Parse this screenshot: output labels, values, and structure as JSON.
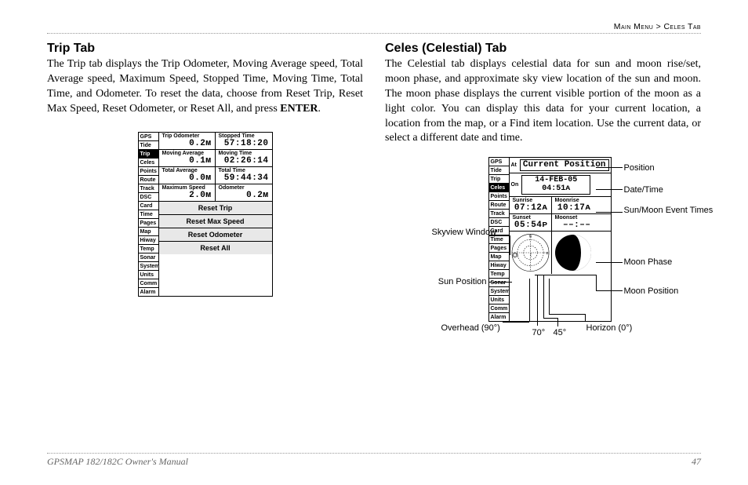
{
  "header": {
    "breadcrumb_left": "Main Menu",
    "breadcrumb_sep": " > ",
    "breadcrumb_right": "Celes Tab"
  },
  "left": {
    "title": "Trip Tab",
    "para_a": "The Trip tab displays the Trip Odometer, Moving Average speed, Total Average speed, Maximum Speed, Stopped Time, Moving Time, Total Time, and Odometer. To reset the data, choose from Reset Trip, Reset Max Speed, Reset Odometer, or Reset All, and press ",
    "para_b": "ENTER",
    "para_c": "."
  },
  "right": {
    "title": "Celes (Celestial) Tab",
    "para": "The Celestial tab displays celestial data for sun and moon rise/set, moon phase, and approximate sky view location of the sun and moon. The moon phase displays the current visible portion of the moon as a light color. You can display this data for your current location, a location from the map, or a Find item location. Use the current data, or select a different date and time."
  },
  "nav_items": [
    "GPS",
    "Tide",
    "Trip",
    "Celes",
    "Points",
    "Route",
    "Track",
    "DSC",
    "Card",
    "Time",
    "Pages",
    "Map",
    "Hiway",
    "Temp",
    "Sonar",
    "System",
    "Units",
    "Comm",
    "Alarm"
  ],
  "nav_sel_trip": "Trip",
  "nav_sel_celes": "Celes",
  "trip": {
    "r1": {
      "l_lab": "Trip Odometer",
      "l_val": "0.2ᴍ",
      "r_lab": "Stopped Time",
      "r_val": "57:18:20"
    },
    "r2": {
      "l_lab": "Moving Average",
      "l_val": "0.1ᴍ",
      "r_lab": "Moving Time",
      "r_val": "02:26:14"
    },
    "r3": {
      "l_lab": "Total Average",
      "l_val": "0.0ᴍ",
      "r_lab": "Total Time",
      "r_val": "59:44:34"
    },
    "r4": {
      "l_lab": "Maximum Speed",
      "l_val": "2.0ᴍ",
      "r_lab": "Odometer",
      "r_val": "0.2ᴍ"
    },
    "btn1": "Reset Trip",
    "btn2": "Reset Max Speed",
    "btn3": "Reset Odometer",
    "btn4": "Reset All"
  },
  "celes": {
    "at_lab": "At",
    "at_val": "Current Position",
    "on_lab": "On",
    "on_date": "14-FEB-05",
    "on_time": "04:51ᴀ",
    "sunrise_lab": "Sunrise",
    "sunrise": "07:12ᴀ",
    "moonrise_lab": "Moonrise",
    "moonrise": "10:17ᴀ",
    "sunset_lab": "Sunset",
    "sunset": "05:54ᴘ",
    "moonset_lab": "Moonset",
    "moonset": "––:––"
  },
  "callouts": {
    "position": "Position",
    "datetime": "Date/Time",
    "events": "Sun/Moon Event Times",
    "moonphase": "Moon Phase",
    "moonpos": "Moon Position",
    "skyview": "Skyview Window",
    "sunpos": "Sun Position",
    "overhead": "Overhead (90°)",
    "seventy": "70°",
    "fortyfive": "45°",
    "horizon": "Horizon (0°)"
  },
  "footer": {
    "left": "GPSMAP 182/182C Owner's Manual",
    "right": "47"
  }
}
